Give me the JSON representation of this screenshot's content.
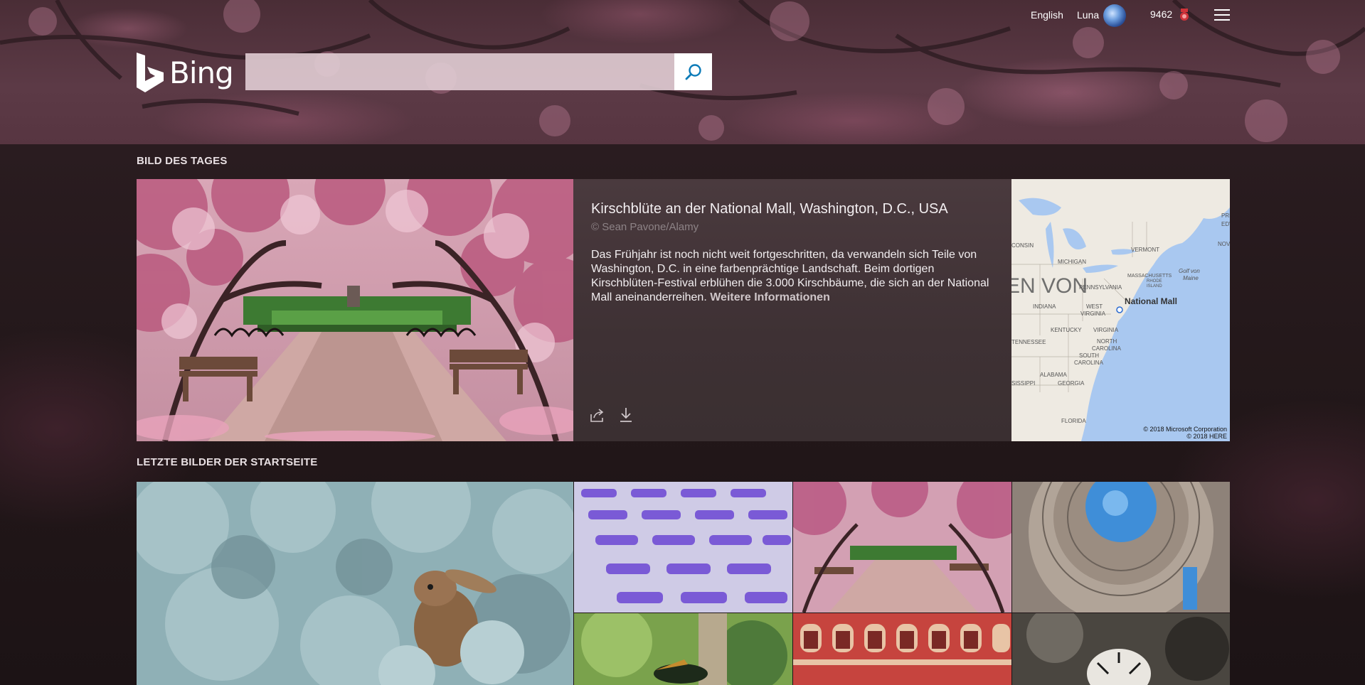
{
  "header": {
    "language": "English",
    "user_name": "Luna",
    "points": "9462",
    "logo_text": "Bing",
    "search_placeholder": ""
  },
  "picture_of_day": {
    "section_title": "BILD DES TAGES",
    "title": "Kirschblüte an der National Mall, Washington, D.C., USA",
    "credit": "© Sean Pavone/Alamy",
    "description": "Das Frühjahr ist noch nicht weit fortgeschritten, da verwandeln sich Teile von Washington, D.C. in eine farbenprächtige Landschaft. Beim dortigen Kirschblüten-Festival erblühen die 3.000 Kirschbäume, die sich an der National Mall aneinanderreihen.",
    "more_link": "Weitere Informationen"
  },
  "map": {
    "labels": [
      "CONSIN",
      "MICHIGAN",
      "VERMONT",
      "NOVA S",
      "MASSACHUSETTS",
      "Golf von Maine",
      "RHODE ISLAND",
      "PENNSYLVANIA",
      "EN VON",
      "INDIANA",
      "WEST VIRGINIA",
      "National Mall",
      "KENTUCKY",
      "VIRGINIA",
      "TENNESSEE",
      "NORTH CAROLINA",
      "SOUTH CAROLINA",
      "ALABAMA",
      "SISSIPPI",
      "GEORGIA",
      "FLORIDA",
      "PRI",
      "EDV"
    ],
    "copyright_1": "© 2018 Microsoft Corporation",
    "copyright_2": "© 2018 HERE"
  },
  "recent": {
    "section_title": "LETZTE BILDER DER STARTSEITE"
  },
  "colors": {
    "accent": "#1a8ccf"
  }
}
